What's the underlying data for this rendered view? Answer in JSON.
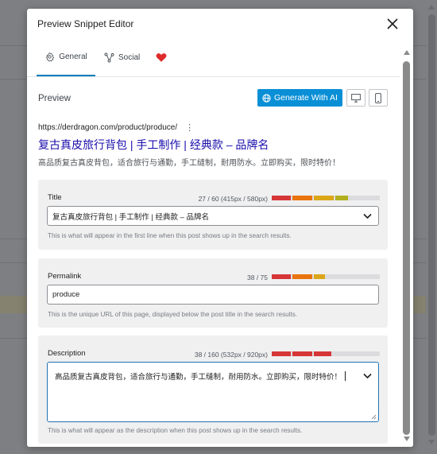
{
  "modal": {
    "title": "Preview Snippet Editor",
    "close_icon": "close-icon"
  },
  "tabs": [
    {
      "label": "General",
      "icon": "gear-icon",
      "active": true
    },
    {
      "label": "Social",
      "icon": "share-icon",
      "active": false
    },
    {
      "label": "",
      "icon": "heart-icon",
      "active": false
    }
  ],
  "preview": {
    "label": "Preview",
    "generate_button": "Generate With AI",
    "desktop_icon": "desktop-icon",
    "mobile_icon": "mobile-icon",
    "url": "https://derdragon.com/product/produce/",
    "more_icon": "more-vertical-icon",
    "title": "复古真皮旅行背包 | 手工制作 | 经典款 – 品牌名",
    "description": "高品质复古真皮背包，适合旅行与通勤，手工缝制，耐用防水。立即购买，限时特价！"
  },
  "fields": {
    "title": {
      "label": "Title",
      "count": "27 / 60 (415px / 580px)",
      "value": "复古真皮旅行背包 | 手工制作 | 经典款 – 品牌名",
      "hint": "This is what will appear in the first line when this post shows up in the search results.",
      "meter_level": 0.72
    },
    "permalink": {
      "label": "Permalink",
      "count": "38 / 75",
      "value": "produce",
      "hint": "This is the unique URL of this page, displayed below the post title in the search results.",
      "meter_level": 0.5
    },
    "description": {
      "label": "Description",
      "count": "38 / 160 (532px / 920px)",
      "value": "高品质复古真皮背包，适合旅行与通勤，手工缝制，耐用防水。立即购买，限时特价！",
      "hint": "This is what will appear as the description when this post shows up in the search results.",
      "meter_level": 0.56
    }
  },
  "colors": {
    "accent": "#0a8fd6",
    "link_title": "#1a0dab",
    "meter_red": "#d63638",
    "meter_orange": "#e9730c",
    "meter_yellow": "#dba617",
    "meter_olive": "#b2b01f",
    "heart": "#e02b2b"
  }
}
